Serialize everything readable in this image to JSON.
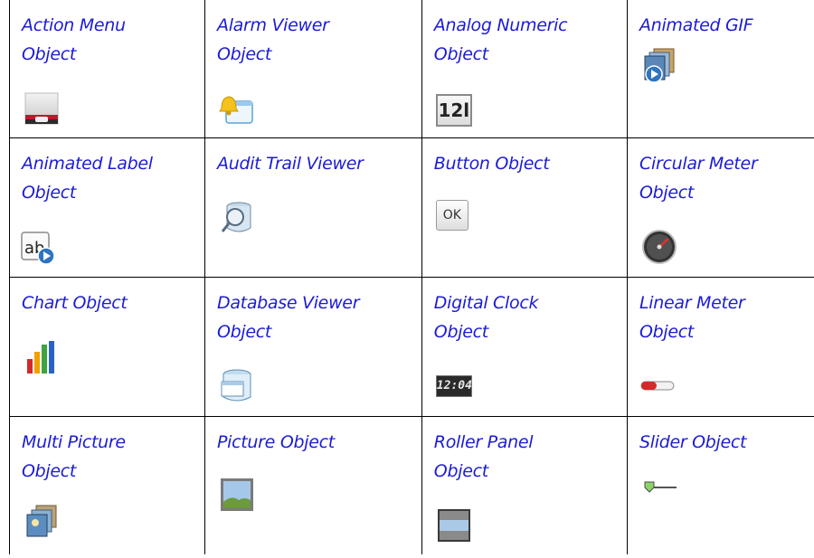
{
  "objects": [
    {
      "label": "Action Menu Object",
      "icon": "action-menu-icon"
    },
    {
      "label": "Alarm Viewer Object",
      "icon": "alarm-viewer-icon"
    },
    {
      "label": "Analog Numeric Object",
      "icon": "analog-numeric-icon",
      "icon_text": "12l"
    },
    {
      "label": "Animated GIF",
      "icon": "animated-gif-icon"
    },
    {
      "label": "Animated Label Object",
      "icon": "animated-label-icon",
      "icon_text": "ab"
    },
    {
      "label": "Audit Trail Viewer",
      "icon": "audit-trail-icon"
    },
    {
      "label": "Button Object",
      "icon": "button-icon",
      "icon_text": "OK"
    },
    {
      "label": "Circular Meter Object",
      "icon": "circular-meter-icon"
    },
    {
      "label": "Chart Object",
      "icon": "chart-icon"
    },
    {
      "label": "Database Viewer Object",
      "icon": "database-viewer-icon"
    },
    {
      "label": "Digital Clock Object",
      "icon": "digital-clock-icon",
      "icon_text": "12:04"
    },
    {
      "label": "Linear Meter Object",
      "icon": "linear-meter-icon"
    },
    {
      "label": "Multi Picture Object",
      "icon": "multi-picture-icon"
    },
    {
      "label": "Picture Object",
      "icon": "picture-icon"
    },
    {
      "label": "Roller Panel Object",
      "icon": "roller-panel-icon"
    },
    {
      "label": "Slider Object",
      "icon": "slider-icon"
    }
  ]
}
